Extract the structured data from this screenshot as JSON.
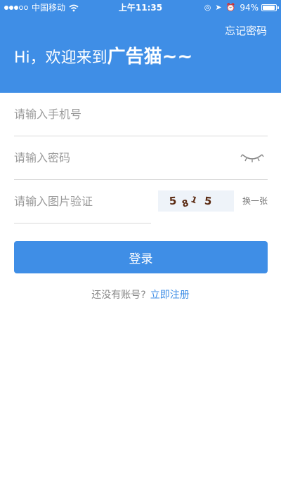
{
  "status_bar": {
    "carrier": "中国移动",
    "time": "上午11:35",
    "battery_percent": "94%",
    "battery_level": 0.94
  },
  "header": {
    "forgot_password": "忘记密码",
    "greeting": "Hi，欢迎来到",
    "brand": "广告猫~~",
    "background_color": "#3f8ee6"
  },
  "form": {
    "phone_placeholder": "请输入手机号",
    "password_placeholder": "请输入密码",
    "captcha_placeholder": "请输入图片验证",
    "captcha_text": "5 8 1 5",
    "refresh_captcha": "换一张",
    "login_button": "登录"
  },
  "footer": {
    "no_account": "还没有账号?",
    "register_link": "立即注册"
  },
  "icons": {
    "password_toggle": "eye-closed-icon"
  }
}
